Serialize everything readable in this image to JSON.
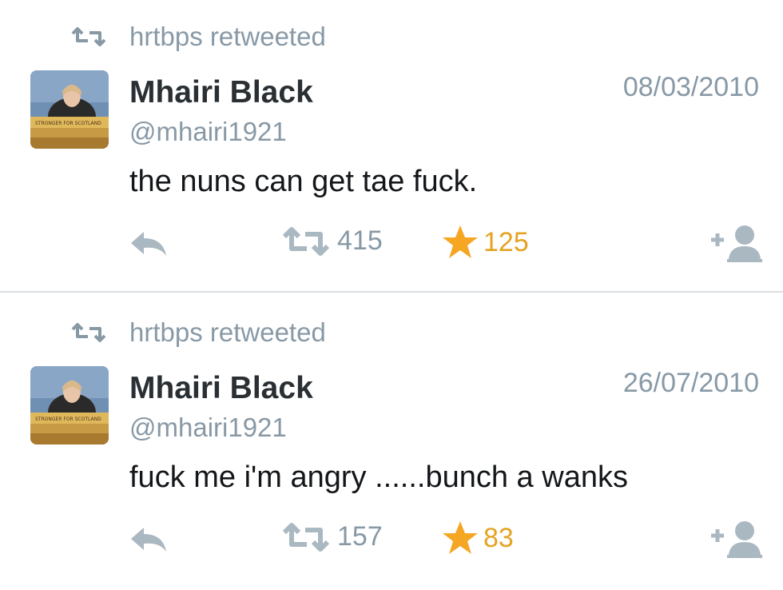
{
  "tweets": [
    {
      "retweeted_by": "hrtbps retweeted",
      "name": "Mhairi Black",
      "handle": "@mhairi1921",
      "date": "08/03/2010",
      "text": "the nuns can get tae fuck.",
      "retweets": "415",
      "favorites": "125",
      "avatar_sign": "STRONGER FOR SCOTLAND"
    },
    {
      "retweeted_by": "hrtbps retweeted",
      "name": "Mhairi Black",
      "handle": "@mhairi1921",
      "date": "26/07/2010",
      "text": "fuck me i'm angry ......bunch a wanks",
      "retweets": "157",
      "favorites": "83",
      "avatar_sign": "STRONGER FOR SCOTLAND"
    }
  ],
  "colors": {
    "muted": "#8899a6",
    "text": "#14171a",
    "name": "#292f33",
    "favorite": "#e5a323",
    "divider": "#dcdfe3"
  },
  "icons": [
    "retweet-icon",
    "reply-icon",
    "star-icon",
    "follow-icon"
  ]
}
